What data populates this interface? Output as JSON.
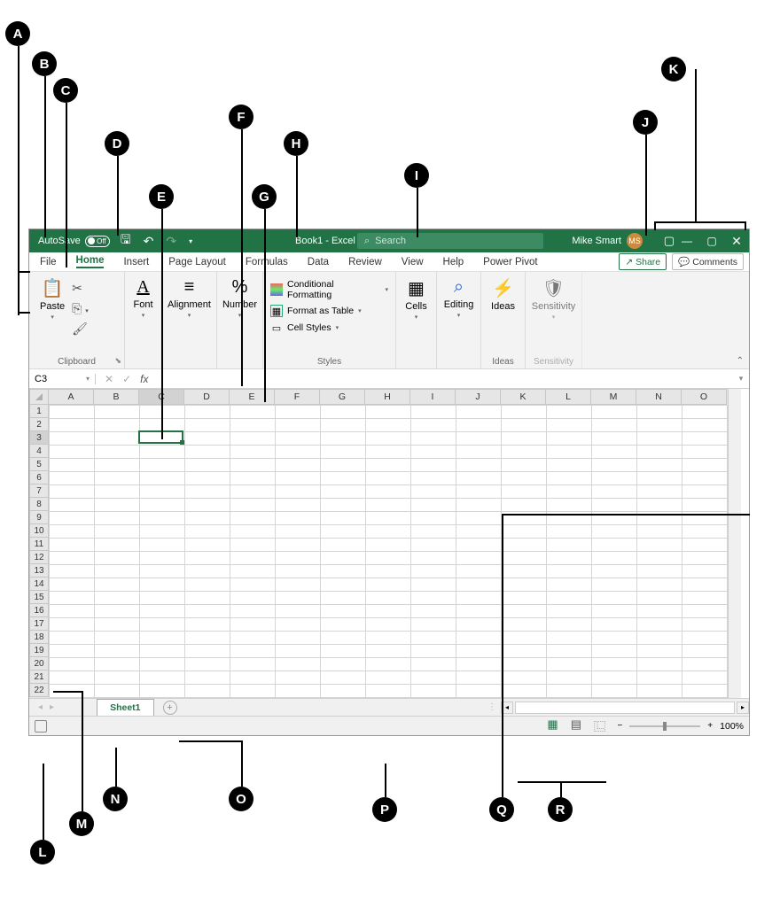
{
  "titlebar": {
    "autosave_label": "AutoSave",
    "autosave_state": "Off",
    "doc_title": "Book1 - Excel",
    "search_placeholder": "Search",
    "user_name": "Mike Smart",
    "user_initials": "MS"
  },
  "tabs": {
    "items": [
      "File",
      "Home",
      "Insert",
      "Page Layout",
      "Formulas",
      "Data",
      "Review",
      "View",
      "Help",
      "Power Pivot"
    ],
    "active": "Home",
    "share": "Share",
    "comments": "Comments"
  },
  "ribbon": {
    "clipboard": {
      "label": "Clipboard",
      "paste": "Paste"
    },
    "font": {
      "label": "Font"
    },
    "alignment": {
      "label": "Alignment"
    },
    "number": {
      "label": "Number"
    },
    "styles": {
      "label": "Styles",
      "cond": "Conditional Formatting",
      "table": "Format as Table",
      "cell": "Cell Styles"
    },
    "cells": {
      "label": "Cells"
    },
    "editing": {
      "label": "Editing"
    },
    "ideas": {
      "label": "Ideas",
      "btn": "Ideas"
    },
    "sensitivity": {
      "label": "Sensitivity",
      "btn": "Sensitivity"
    }
  },
  "formula_bar": {
    "name_box": "C3"
  },
  "grid": {
    "columns": [
      "A",
      "B",
      "C",
      "D",
      "E",
      "F",
      "G",
      "H",
      "I",
      "J",
      "K",
      "L",
      "M",
      "N",
      "O"
    ],
    "rows": 22,
    "active_col": "C",
    "active_row": 3
  },
  "sheetbar": {
    "sheet_name": "Sheet1"
  },
  "statusbar": {
    "zoom": "100%"
  },
  "callouts": {
    "A": "A",
    "B": "B",
    "C": "C",
    "D": "D",
    "E": "E",
    "F": "F",
    "G": "G",
    "H": "H",
    "I": "I",
    "J": "J",
    "K": "K",
    "L": "L",
    "M": "M",
    "N": "N",
    "O": "O",
    "P": "P",
    "Q": "Q",
    "R": "R"
  }
}
